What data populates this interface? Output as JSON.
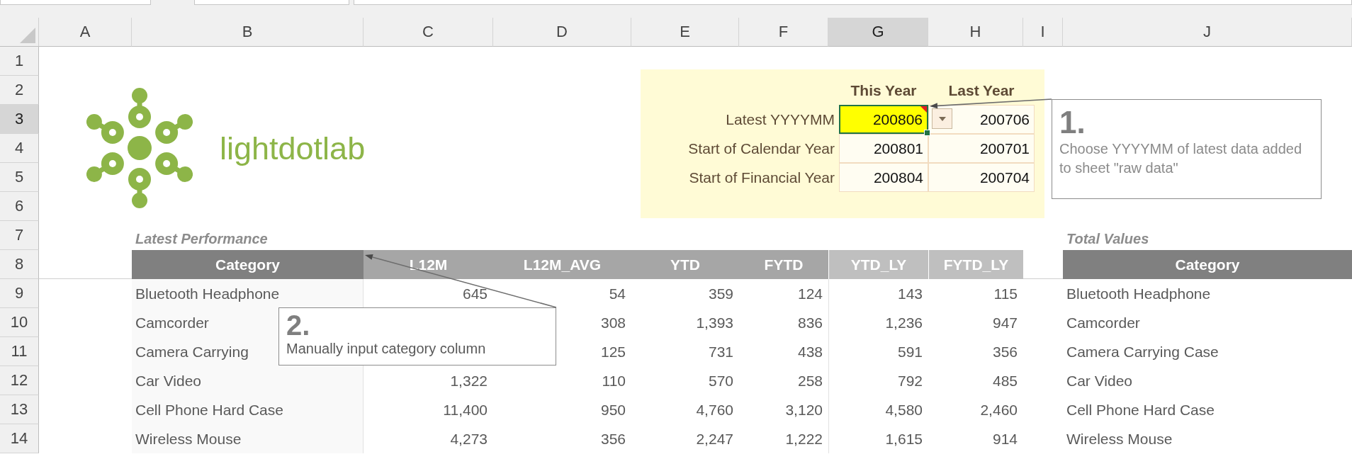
{
  "columns": [
    {
      "label": "A",
      "selected": false
    },
    {
      "label": "B",
      "selected": false
    },
    {
      "label": "C",
      "selected": false
    },
    {
      "label": "D",
      "selected": false
    },
    {
      "label": "E",
      "selected": false
    },
    {
      "label": "F",
      "selected": false
    },
    {
      "label": "G",
      "selected": true
    },
    {
      "label": "H",
      "selected": false
    },
    {
      "label": "I",
      "selected": false
    },
    {
      "label": "J",
      "selected": false
    }
  ],
  "rows": [
    {
      "label": "1",
      "selected": false
    },
    {
      "label": "2",
      "selected": false
    },
    {
      "label": "3",
      "selected": true
    },
    {
      "label": "4",
      "selected": false
    },
    {
      "label": "5",
      "selected": false
    },
    {
      "label": "6",
      "selected": false
    },
    {
      "label": "7",
      "selected": false
    },
    {
      "label": "8",
      "selected": false
    },
    {
      "label": "9",
      "selected": false
    },
    {
      "label": "10",
      "selected": false
    },
    {
      "label": "11",
      "selected": false
    },
    {
      "label": "12",
      "selected": false
    },
    {
      "label": "13",
      "selected": false
    },
    {
      "label": "14",
      "selected": false
    }
  ],
  "logo": {
    "text": "lightdotlab"
  },
  "parameters": {
    "headers": [
      "This Year",
      "Last Year"
    ],
    "rows": [
      {
        "label": "Latest YYYYMM",
        "this_year": "200806",
        "last_year": "200706",
        "selected": true,
        "highlight": true,
        "comment": true,
        "dropdown": true
      },
      {
        "label": "Start of Calendar Year",
        "this_year": "200801",
        "last_year": "200701",
        "selected": false,
        "highlight": false,
        "comment": false,
        "dropdown": false
      },
      {
        "label": "Start of Financial Year",
        "this_year": "200804",
        "last_year": "200704",
        "selected": false,
        "highlight": false,
        "comment": false,
        "dropdown": false
      }
    ]
  },
  "callouts": [
    {
      "number": "1.",
      "text": "Choose YYYYMM of latest data added to sheet \"raw data\""
    },
    {
      "number": "2.",
      "text": "Manually input category column"
    }
  ],
  "latest_performance": {
    "title": "Latest Performance",
    "columns": [
      {
        "label": "Category",
        "kind": "category"
      },
      {
        "label": "L12M",
        "kind": "current"
      },
      {
        "label": "L12M_AVG",
        "kind": "current"
      },
      {
        "label": "YTD",
        "kind": "current"
      },
      {
        "label": "FYTD",
        "kind": "current"
      },
      {
        "label": "YTD_LY",
        "kind": "prior"
      },
      {
        "label": "FYTD_LY",
        "kind": "prior"
      }
    ],
    "rows": [
      {
        "category": "Bluetooth Headphone",
        "l12m": "645",
        "l12m_avg": "54",
        "ytd": "359",
        "fytd": "124",
        "ytd_ly": "143",
        "fytd_ly": "115"
      },
      {
        "category": "Camcorder",
        "l12m_avg": "308",
        "ytd": "1,393",
        "fytd": "836",
        "ytd_ly": "1,236",
        "fytd_ly": "947"
      },
      {
        "category": "Camera Carrying",
        "l12m_avg": "125",
        "ytd": "731",
        "fytd": "438",
        "ytd_ly": "591",
        "fytd_ly": "356"
      },
      {
        "category": "Car Video",
        "l12m": "1,322",
        "l12m_avg": "110",
        "ytd": "570",
        "fytd": "258",
        "ytd_ly": "792",
        "fytd_ly": "485"
      },
      {
        "category": "Cell Phone Hard Case",
        "l12m": "11,400",
        "l12m_avg": "950",
        "ytd": "4,760",
        "fytd": "3,120",
        "ytd_ly": "4,580",
        "fytd_ly": "2,460"
      },
      {
        "category": "Wireless Mouse",
        "l12m": "4,273",
        "l12m_avg": "356",
        "ytd": "2,247",
        "fytd": "1,222",
        "ytd_ly": "1,615",
        "fytd_ly": "914"
      }
    ]
  },
  "total_values": {
    "title": "Total Values",
    "column": {
      "label": "Category",
      "kind": "category"
    },
    "rows": [
      "Bluetooth Headphone",
      "Camcorder",
      "Camera Carrying Case",
      "Car Video",
      "Cell Phone Hard Case",
      "Wireless Mouse"
    ]
  }
}
